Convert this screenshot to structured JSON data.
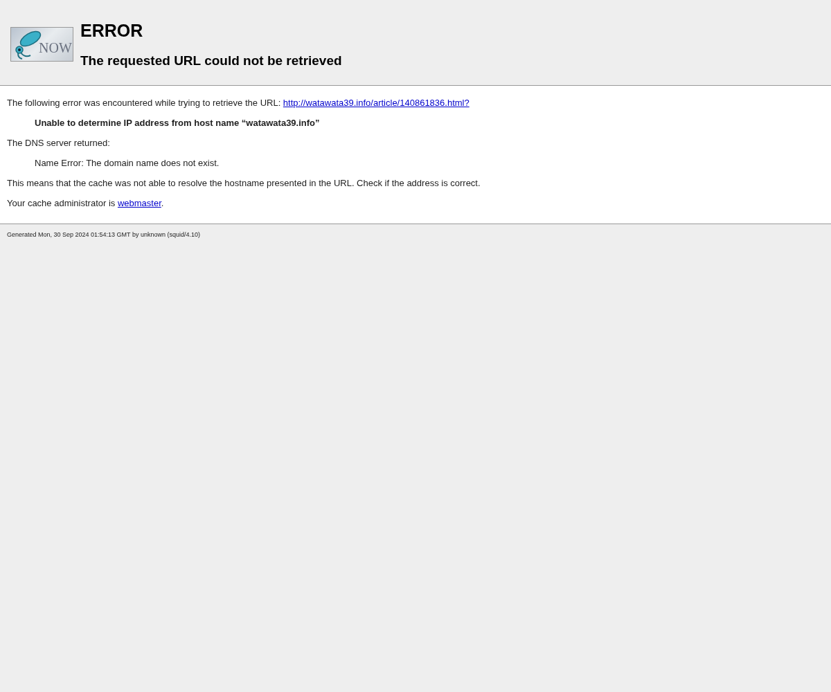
{
  "logo": {
    "text": "NOW"
  },
  "title": "ERROR",
  "subtitle": "The requested URL could not be retrieved",
  "intro": {
    "text": "The following error was encountered while trying to retrieve the URL: ",
    "link": "http://watawata39.info/article/140861836.html?"
  },
  "error": "Unable to determine IP address from host name “watawata39.info”",
  "dns_label": "The DNS server returned:",
  "dns_detail": "Name Error: The domain name does not exist.",
  "explanation": "This means that the cache was not able to resolve the hostname presented in the URL. Check if the address is correct.",
  "admin": {
    "text": "Your cache administrator is ",
    "link": "webmaster",
    "after": "."
  },
  "footer": "Generated Mon, 30 Sep 2024 01:54:13 GMT by unknown (squid/4.10)"
}
